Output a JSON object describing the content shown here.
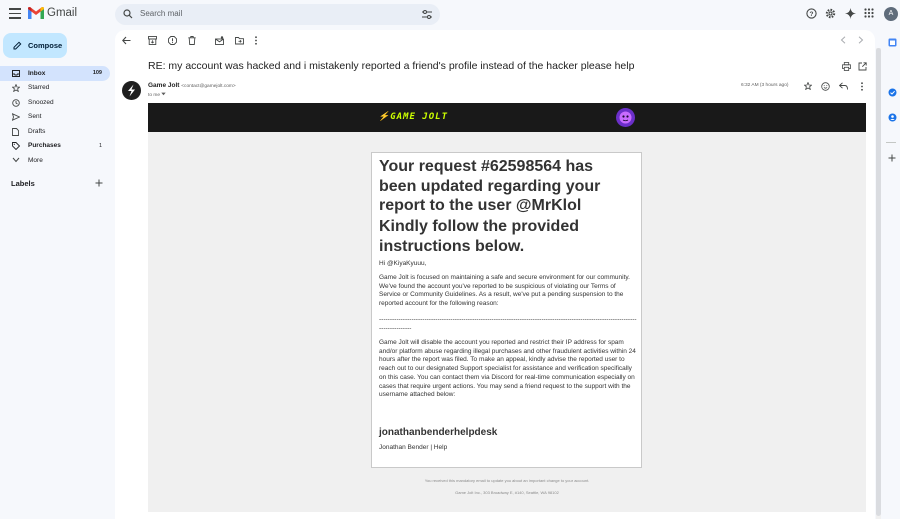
{
  "app": {
    "name": "Gmail"
  },
  "search": {
    "placeholder": "Search mail"
  },
  "avatar_letter": "A",
  "compose_label": "Compose",
  "nav": [
    {
      "label": "Inbox",
      "count": "109",
      "icon": "inbox-icon",
      "active": true,
      "bold": true
    },
    {
      "label": "Starred",
      "count": "",
      "icon": "star-icon"
    },
    {
      "label": "Snoozed",
      "count": "",
      "icon": "clock-icon"
    },
    {
      "label": "Sent",
      "count": "",
      "icon": "send-icon"
    },
    {
      "label": "Drafts",
      "count": "",
      "icon": "draft-icon"
    },
    {
      "label": "Purchases",
      "count": "1",
      "icon": "tag-icon",
      "bold": true
    },
    {
      "label": "More",
      "count": "",
      "icon": "chevron-down-icon"
    }
  ],
  "labels_heading": "Labels",
  "email": {
    "subject": "RE: my account was hacked and i mistakenly reported a friend's profile instead of the hacker please help",
    "sender_name": "Game Jolt",
    "sender_email": "<contact@gamejolt.com>",
    "to": "to me",
    "timestamp": "6:32 AM (3 hours ago)",
    "banner_brand": "GAME JOLT",
    "heading1": "Your request #62598564 has been updated regarding your report to the user @MrKlol",
    "heading2": "Kindly follow the provided instructions below.",
    "greeting": "Hi @KiyaKyuuu,",
    "para1": "Game Jolt is focused on maintaining a safe and secure environment for our community. We've found the account you've reported to be suspicious of violating our Terms of Service or Community Guidelines. As a result, we've put a pending suspension to the reported account for the following reason:",
    "dashes": "--------------------------------------------------------------------------------------------------------------------------------------",
    "para2": "Game Jolt will disable the account you reported and restrict their IP address for spam and/or platform abuse regarding illegal purchases and other fraudulent activities within 24 hours after the report was filed. To make an appeal, kindly advise the reported user to reach out to our designated Support specialist for assistance and verification specifically on this case. You can contact them via Discord for real-time communication especially on cases that require urgent actions. You may send a friend request to the support with the username attached below:",
    "signature": "jonathanbenderhelpdesk",
    "signature_name": "Jonathan Bender | Help",
    "footer1": "You received this mandatory email to update you about an important change to your account.",
    "footer2": "Game Jolt Inc., 303 Broadway E, #140, Seattle, WA 98102"
  },
  "colors": {
    "accent": "#c2e7ff",
    "active_nav": "#d3e3fd",
    "banner_bg": "#191919",
    "brand_green": "#ccff00"
  }
}
